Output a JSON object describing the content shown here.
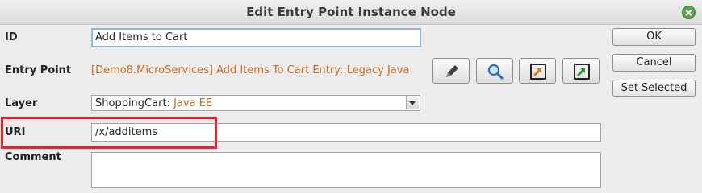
{
  "dialog": {
    "title": "Edit Entry Point Instance Node"
  },
  "labels": {
    "id": "ID",
    "entry_point": "Entry Point",
    "layer": "Layer",
    "uri": "URI",
    "comment": "Comment"
  },
  "fields": {
    "id_value": "Add Items to Cart",
    "entry_point_value": "[Demo8.MicroServices] Add Items To Cart Entry::Legacy Java",
    "layer_name": "ShoppingCart:",
    "layer_type": "Java EE",
    "uri_value": "/x/additems",
    "comment_value": ""
  },
  "buttons": {
    "ok": "OK",
    "cancel": "Cancel",
    "set_selected": "Set Selected"
  },
  "icons": {
    "edit": "pencil-icon",
    "search": "magnifier-icon",
    "go_orange": "navigate-orange-icon",
    "go_green": "navigate-green-icon"
  },
  "colors": {
    "entry_point_text": "#c96a1e",
    "highlight_box": "#e0262d",
    "close_button": "#5da34f"
  }
}
